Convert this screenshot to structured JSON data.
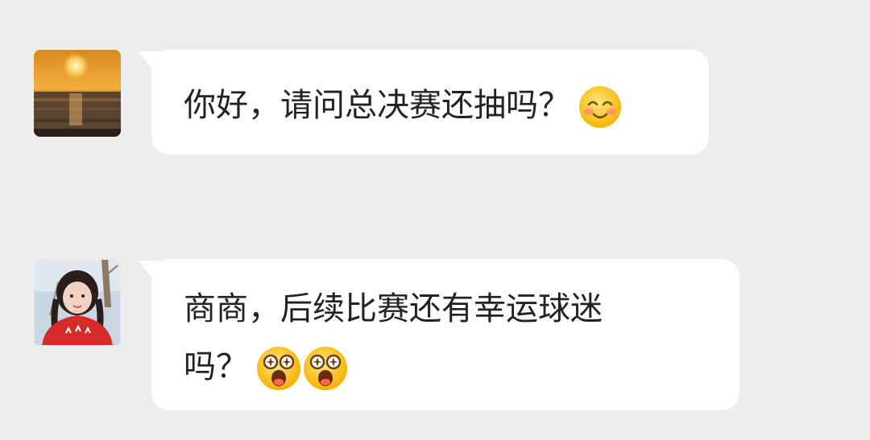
{
  "chat": {
    "messages": [
      {
        "avatar": "sunset-avatar",
        "text": "你好，请问总决赛还抽吗？",
        "emojis": [
          "smiling-face-icon"
        ]
      },
      {
        "avatar": "girl-avatar",
        "line1": "商商，后续比赛还有幸运球迷",
        "line2": "吗？",
        "emojis": [
          "surprised-face-icon",
          "surprised-face-icon"
        ]
      }
    ]
  }
}
